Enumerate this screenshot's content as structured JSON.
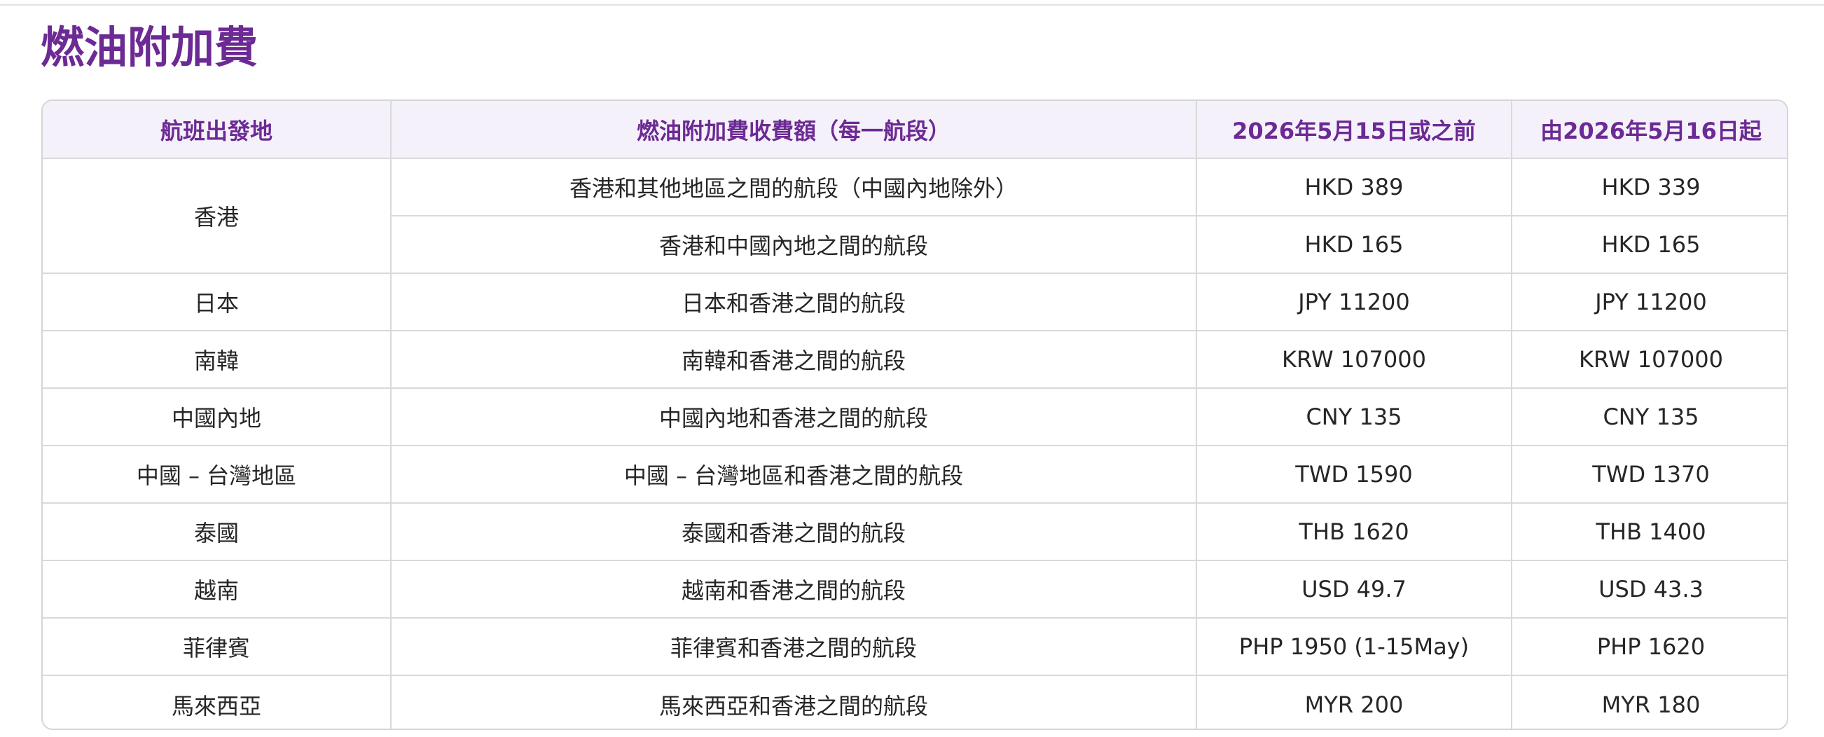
{
  "page": {
    "title": "燃油附加費"
  },
  "table": {
    "headers": [
      "航班出發地",
      "燃油附加費收費額（每一航段）",
      "2026年5月15日或之前",
      "由2026年5月16日起"
    ],
    "rows": [
      {
        "origin": "香港",
        "sector": "香港和其他地區之間的航段（中國內地除外）",
        "before": "HKD 389",
        "from": "HKD 339"
      },
      {
        "origin": "",
        "sector": "香港和中國內地之間的航段",
        "before": "HKD 165",
        "from": "HKD 165"
      },
      {
        "origin": "日本",
        "sector": "日本和香港之間的航段",
        "before": "JPY 11200",
        "from": "JPY 11200"
      },
      {
        "origin": "南韓",
        "sector": "南韓和香港之間的航段",
        "before": "KRW 107000",
        "from": "KRW 107000"
      },
      {
        "origin": "中國內地",
        "sector": "中國內地和香港之間的航段",
        "before": "CNY 135",
        "from": "CNY 135"
      },
      {
        "origin": "中國 – 台灣地區",
        "sector": "中國 – 台灣地區和香港之間的航段",
        "before": "TWD 1590",
        "from": "TWD 1370"
      },
      {
        "origin": "泰國",
        "sector": "泰國和香港之間的航段",
        "before": "THB 1620",
        "from": "THB 1400"
      },
      {
        "origin": "越南",
        "sector": "越南和香港之間的航段",
        "before": "USD 49.7",
        "from": "USD 43.3"
      },
      {
        "origin": "菲律賓",
        "sector": "菲律賓和香港之間的航段",
        "before": "PHP 1950 (1-15May)",
        "from": "PHP 1620"
      },
      {
        "origin": "馬來西亞",
        "sector": "馬來西亞和香港之間的航段",
        "before": "MYR 200",
        "from": "MYR 180"
      }
    ]
  },
  "colors": {
    "accent": "#6c2a94",
    "header_bg": "#f5f1fa",
    "border": "#d9d9d9"
  }
}
